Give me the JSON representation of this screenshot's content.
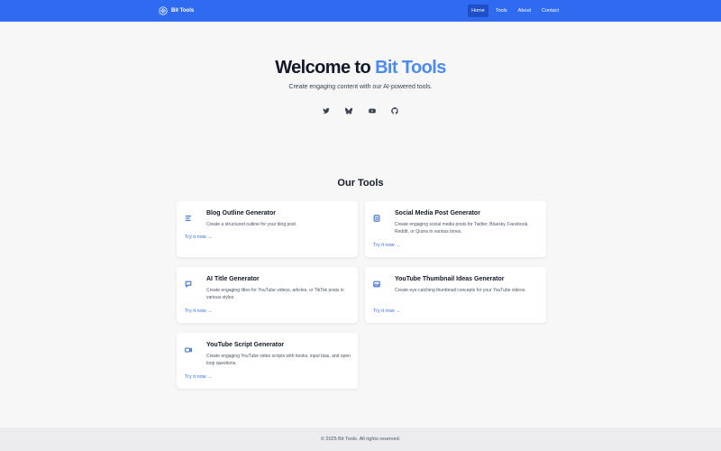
{
  "navbar": {
    "brand": "Bit Tools",
    "links": [
      {
        "label": "Home",
        "active": true
      },
      {
        "label": "Tools",
        "active": false
      },
      {
        "label": "About",
        "active": false
      },
      {
        "label": "Contact",
        "active": false
      }
    ],
    "color": "#2f6bf0"
  },
  "hero": {
    "title_prefix": "Welcome to",
    "title_accent": "Bit Tools",
    "subtitle": "Create engaging content with our AI-powered tools.",
    "socials": [
      "twitter-icon",
      "bluesky-icon",
      "youtube-icon",
      "github-icon"
    ]
  },
  "tools": {
    "heading": "Our Tools",
    "cards": [
      {
        "icon": "list-icon",
        "title": "Blog Outline Generator",
        "description": "Create a structured outline for your blog post.",
        "link": "Try it now →"
      },
      {
        "icon": "document-icon",
        "title": "Social Media Post Generator",
        "description": "Create engaging social media posts for Twitter, Bluesky, Facebook, Reddit, or Quora in various tones.",
        "link": "Try it now →"
      },
      {
        "icon": "chat-icon",
        "title": "AI Title Generator",
        "description": "Create engaging titles for YouTube videos, articles, or TikTok posts in various styles.",
        "link": "Try it now →"
      },
      {
        "icon": "image-icon",
        "title": "YouTube Thumbnail Ideas Generator",
        "description": "Create eye-catching thumbnail concepts for your YouTube videos.",
        "link": "Try it now →"
      },
      {
        "icon": "video-icon",
        "title": "YouTube Script Generator",
        "description": "Create engaging YouTube video scripts with hooks, input bias, and open loop questions.",
        "link": "Try it now →"
      }
    ]
  },
  "footer": {
    "text": "© 2025 Bit Tools. All rights reserved."
  }
}
